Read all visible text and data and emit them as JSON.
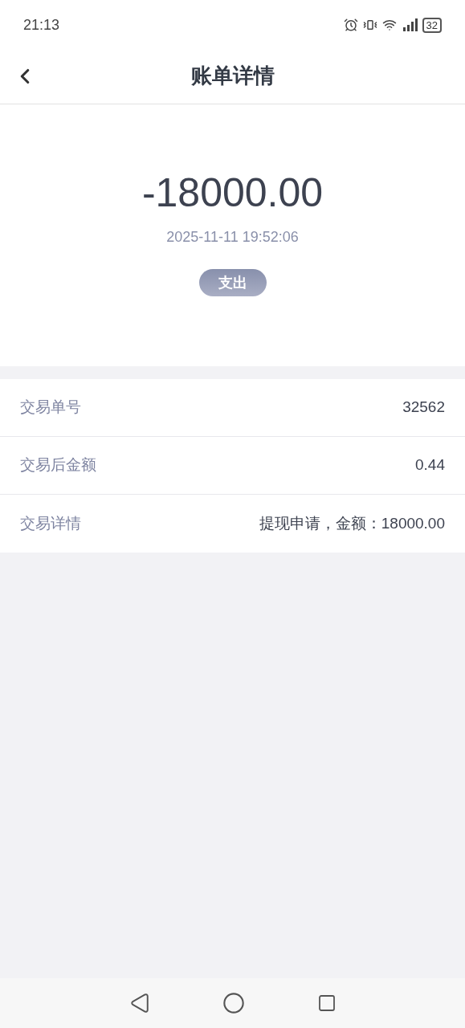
{
  "status_bar": {
    "time": "21:13",
    "battery": "32"
  },
  "header": {
    "title": "账单详情"
  },
  "summary": {
    "amount": "-18000.00",
    "datetime": "2025-11-11 19:52:06",
    "tag": "支出"
  },
  "details": [
    {
      "label": "交易单号",
      "value": "32562"
    },
    {
      "label": "交易后金额",
      "value": "0.44"
    },
    {
      "label": "交易详情",
      "value": "提现申请，金额：18000.00"
    }
  ]
}
